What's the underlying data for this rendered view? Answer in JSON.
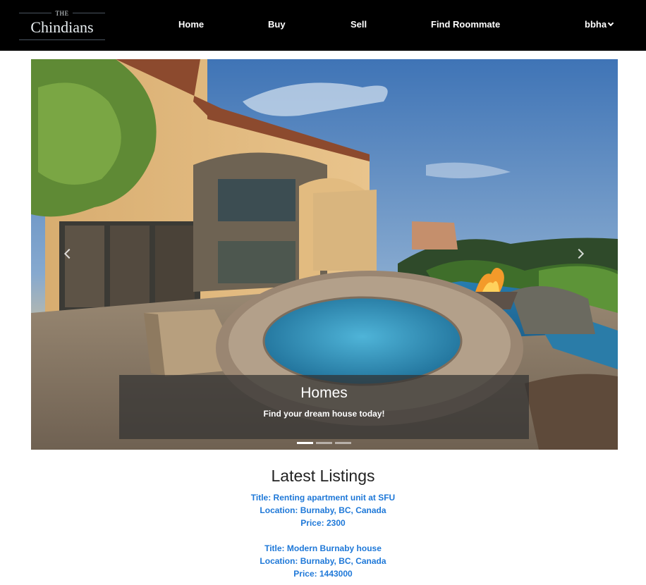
{
  "brand": {
    "the": "THE",
    "name": "Chindians"
  },
  "nav": {
    "home": "Home",
    "buy": "Buy",
    "sell": "Sell",
    "roommate": "Find Roommate",
    "user": "bbha"
  },
  "carousel": {
    "caption_title": "Homes",
    "caption_text": "Find your dream house today!",
    "slide_count": 3,
    "active_slide": 1
  },
  "listings": {
    "heading": "Latest Listings",
    "items": [
      {
        "title": "Title: Renting apartment unit at SFU",
        "location": "Location: Burnaby, BC, Canada",
        "price": "Price: 2300"
      },
      {
        "title": "Title: Modern Burnaby house",
        "location": "Location: Burnaby, BC, Canada",
        "price": "Price: 1443000"
      }
    ]
  },
  "colors": {
    "navbar": "#000000",
    "link": "#1e78d8"
  }
}
